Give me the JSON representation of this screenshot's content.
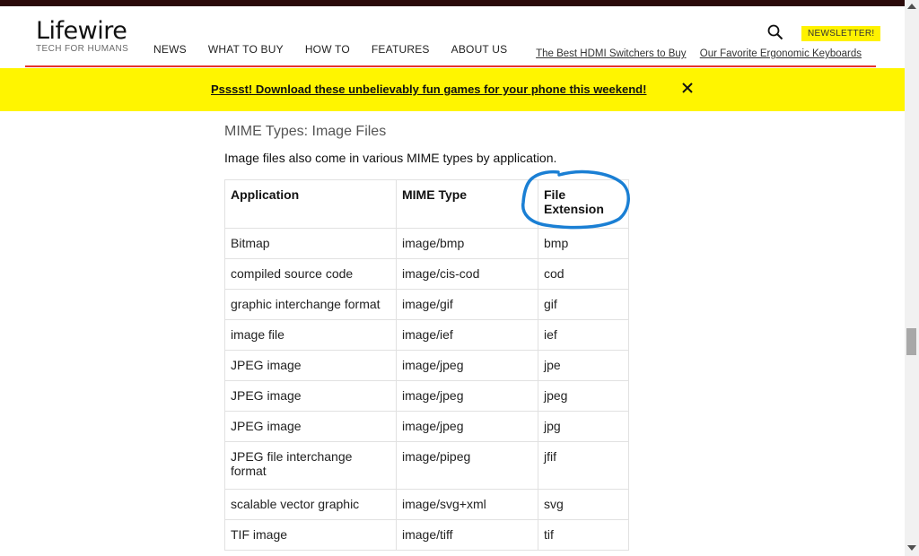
{
  "header": {
    "logo": "Lifewire",
    "tagline": "TECH FOR HUMANS",
    "nav": [
      "NEWS",
      "WHAT TO BUY",
      "HOW TO",
      "FEATURES",
      "ABOUT US"
    ],
    "newsletter_label": "NEWSLETTER!",
    "links": [
      "The Best HDMI Switchers to Buy",
      "Our Favorite Ergonomic Keyboards"
    ]
  },
  "banner": {
    "text": "Psssst! Download these unbelievably fun games for your phone this weekend!"
  },
  "content": {
    "section_title": "MIME Types: Image Files",
    "intro": "Image files also come in various MIME types by application.",
    "table": {
      "headers": [
        "Application",
        "MIME Type",
        "File Extension"
      ],
      "rows": [
        [
          "Bitmap",
          "image/bmp",
          "bmp"
        ],
        [
          "compiled source code",
          "image/cis-cod",
          "cod"
        ],
        [
          "graphic interchange format",
          "image/gif",
          "gif"
        ],
        [
          "image file",
          "image/ief",
          "ief"
        ],
        [
          "JPEG image",
          "image/jpeg",
          "jpe"
        ],
        [
          "JPEG image",
          "image/jpeg",
          "jpeg"
        ],
        [
          "JPEG image",
          "image/jpeg",
          "jpg"
        ],
        [
          "JPEG file interchange format",
          "image/pipeg",
          "jfif"
        ],
        [
          "scalable vector graphic",
          "image/svg+xml",
          "svg"
        ],
        [
          "TIF image",
          "image/tiff",
          "tif"
        ]
      ]
    }
  },
  "colors": {
    "accent_red": "#e4342c",
    "banner_yellow": "#fff500",
    "annotation_blue": "#1a7fd4"
  },
  "icons": [
    "search-icon",
    "close-icon",
    "scroll-up-arrow",
    "scroll-down-arrow"
  ]
}
